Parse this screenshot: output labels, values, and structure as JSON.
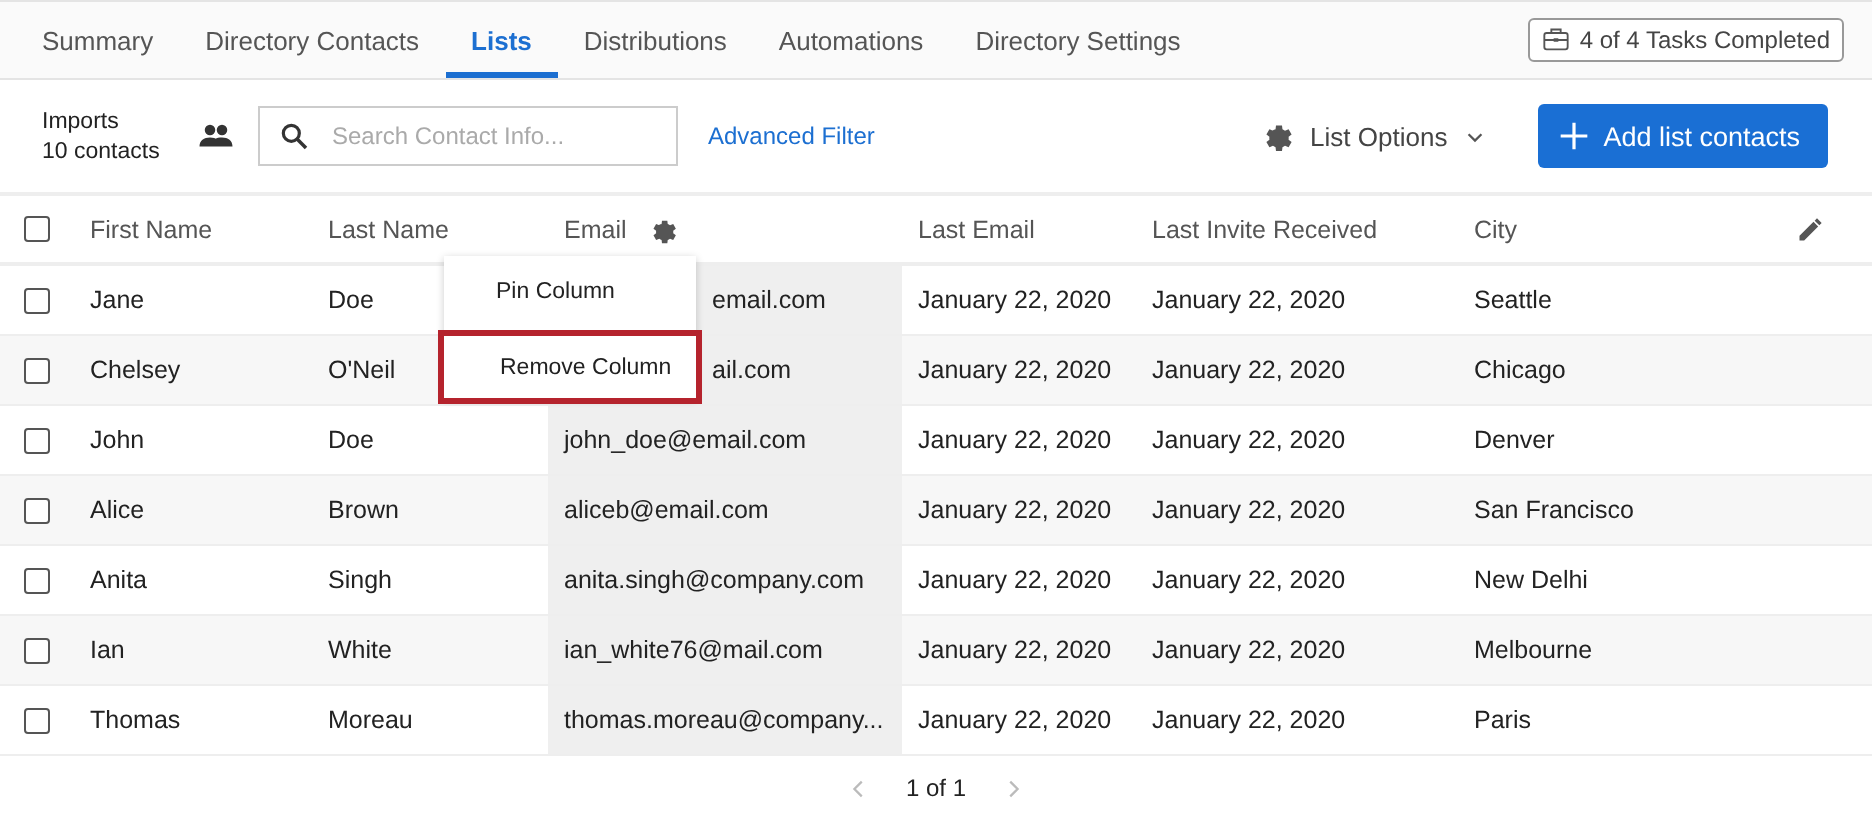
{
  "tabs": [
    {
      "label": "Summary",
      "selected": false
    },
    {
      "label": "Directory Contacts",
      "selected": false
    },
    {
      "label": "Lists",
      "selected": true
    },
    {
      "label": "Distributions",
      "selected": false
    },
    {
      "label": "Automations",
      "selected": false
    },
    {
      "label": "Directory Settings",
      "selected": false
    }
  ],
  "tasks_badge": "4 of 4 Tasks Completed",
  "list_info": {
    "name": "Imports",
    "count": "10 contacts"
  },
  "search": {
    "placeholder": "Search Contact Info..."
  },
  "advanced_filter": "Advanced Filter",
  "list_options": "List Options",
  "add_button": "Add list contacts",
  "table": {
    "select_all": {
      "checked": false
    },
    "columns": [
      {
        "label": "First Name",
        "highlighted": false
      },
      {
        "label": "Last Name",
        "highlighted": false
      },
      {
        "label": "Email",
        "highlighted": true
      },
      {
        "label": "Last Email",
        "highlighted": false
      },
      {
        "label": "Last Invite Received",
        "highlighted": false
      },
      {
        "label": "City",
        "highlighted": false
      }
    ],
    "rows": [
      {
        "checked": false,
        "cells": [
          "Jane",
          "Doe",
          "email.com",
          "January 22, 2020",
          "January 22, 2020",
          "Seattle"
        ]
      },
      {
        "checked": false,
        "cells": [
          "Chelsey",
          "O'Neil",
          "ail.com",
          "January 22, 2020",
          "January 22, 2020",
          "Chicago"
        ]
      },
      {
        "checked": false,
        "cells": [
          "John",
          "Doe",
          "john_doe@email.com",
          "January 22, 2020",
          "January 22, 2020",
          "Denver"
        ]
      },
      {
        "checked": false,
        "cells": [
          "Alice",
          "Brown",
          "aliceb@email.com",
          "January 22, 2020",
          "January 22, 2020",
          "San Francisco"
        ]
      },
      {
        "checked": false,
        "cells": [
          "Anita",
          "Singh",
          "anita.singh@company.com",
          "January 22, 2020",
          "January 22, 2020",
          "New Delhi"
        ]
      },
      {
        "checked": false,
        "cells": [
          "Ian",
          "White",
          "ian_white76@mail.com",
          "January 22, 2020",
          "January 22, 2020",
          "Melbourne"
        ]
      },
      {
        "checked": false,
        "cells": [
          "Thomas",
          "Moreau",
          "thomas.moreau@company...",
          "January 22, 2020",
          "January 22, 2020",
          "Paris"
        ]
      }
    ]
  },
  "column_menu": [
    {
      "label": "Pin Column",
      "focused": false
    },
    {
      "label": "Remove Column",
      "focused": true
    }
  ],
  "pagination": {
    "label": "1 of 1"
  }
}
